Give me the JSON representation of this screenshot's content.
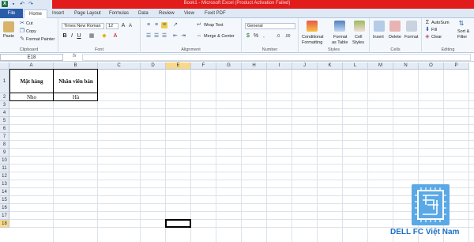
{
  "window": {
    "title": "Book1 - Microsoft Excel (Product Activation Failed)"
  },
  "quick_access": {
    "icons": [
      "excel-icon",
      "save-icon",
      "undo-icon",
      "redo-icon"
    ]
  },
  "tabs": [
    "File",
    "Home",
    "Insert",
    "Page Layout",
    "Formulas",
    "Data",
    "Review",
    "View",
    "Foxit PDF"
  ],
  "ribbon": {
    "clipboard": {
      "paste": "Paste",
      "cut": "Cut",
      "copy": "Copy",
      "format_painter": "Format Painter",
      "label": "Clipboard"
    },
    "font": {
      "font_name": "Times New Roman",
      "font_size": "12",
      "label": "Font"
    },
    "alignment": {
      "wrap_text": "Wrap Text",
      "merge_center": "Merge & Center",
      "label": "Alignment"
    },
    "number": {
      "format": "General",
      "label": "Number"
    },
    "styles": {
      "conditional": "Conditional",
      "conditional2": "Formatting",
      "format_table": "Format",
      "format_table2": "as Table",
      "cell_styles": "Cell",
      "cell_styles2": "Styles",
      "label": "Styles"
    },
    "cells": {
      "insert": "Insert",
      "delete": "Delete",
      "format": "Format",
      "label": "Cells"
    },
    "editing": {
      "autosum": "AutoSum",
      "fill": "Fill",
      "clear": "Clear",
      "sort_filter": "Sort &",
      "sort_filter2": "Filter",
      "label": "Editing"
    }
  },
  "formula_bar": {
    "name_box": "E18",
    "fx": "fx",
    "content": ""
  },
  "sheet": {
    "columns": [
      "A",
      "B",
      "C",
      "D",
      "E",
      "F",
      "G",
      "H",
      "I",
      "J",
      "K",
      "L",
      "M",
      "N",
      "O",
      "P"
    ],
    "rows": [
      "1",
      "2",
      "3",
      "4",
      "5",
      "6",
      "7",
      "8",
      "9",
      "10",
      "11",
      "12",
      "13",
      "14",
      "15",
      "16",
      "17",
      "18"
    ],
    "selected_column": "E",
    "selected_row": "18",
    "cells": {
      "A1": "Mặt hàng",
      "B1": "Nhân viên bán",
      "A2": "Nho",
      "B2": "Hà"
    }
  },
  "watermark": {
    "text": "DELL FC Việt Nam"
  }
}
